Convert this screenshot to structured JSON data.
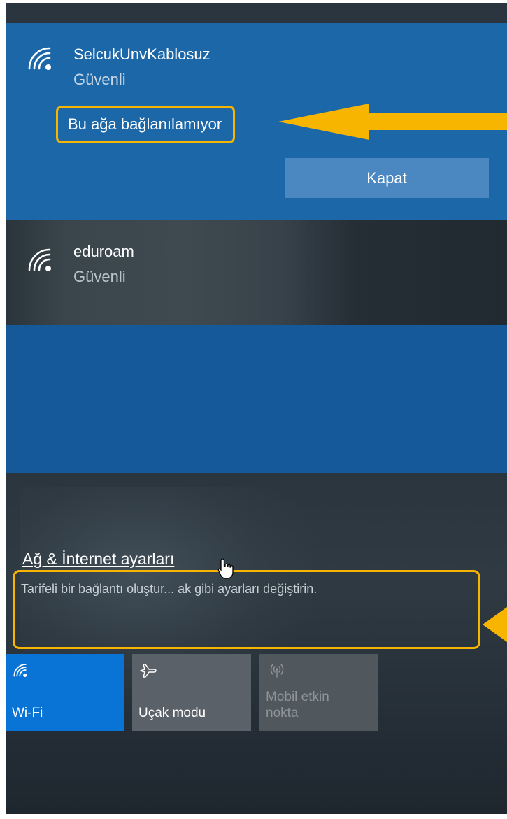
{
  "networks": [
    {
      "name": "SelcukUnvKablosuz",
      "status": "Güvenli",
      "error": "Bu ağa bağlanılamıyor",
      "close_label": "Kapat"
    },
    {
      "name": "eduroam",
      "status": "Güvenli"
    }
  ],
  "settings": {
    "link_label": "Ağ & İnternet ayarları",
    "description": "Tarifeli bir bağlantı oluştur... ak gibi ayarları değiştirin."
  },
  "quick_actions": [
    {
      "label": "Wi-Fi",
      "icon": "wifi-icon",
      "state": "on"
    },
    {
      "label": "Uçak modu",
      "icon": "airplane-icon",
      "state": "off"
    },
    {
      "label": "Mobil etkin nokta",
      "line1": "Mobil etkin",
      "line2": "nokta",
      "icon": "hotspot-icon",
      "state": "disabled"
    }
  ],
  "colors": {
    "accent": "#0a74d6",
    "selected_network_bg": "#1c67a8",
    "highlight": "#f7b500"
  }
}
